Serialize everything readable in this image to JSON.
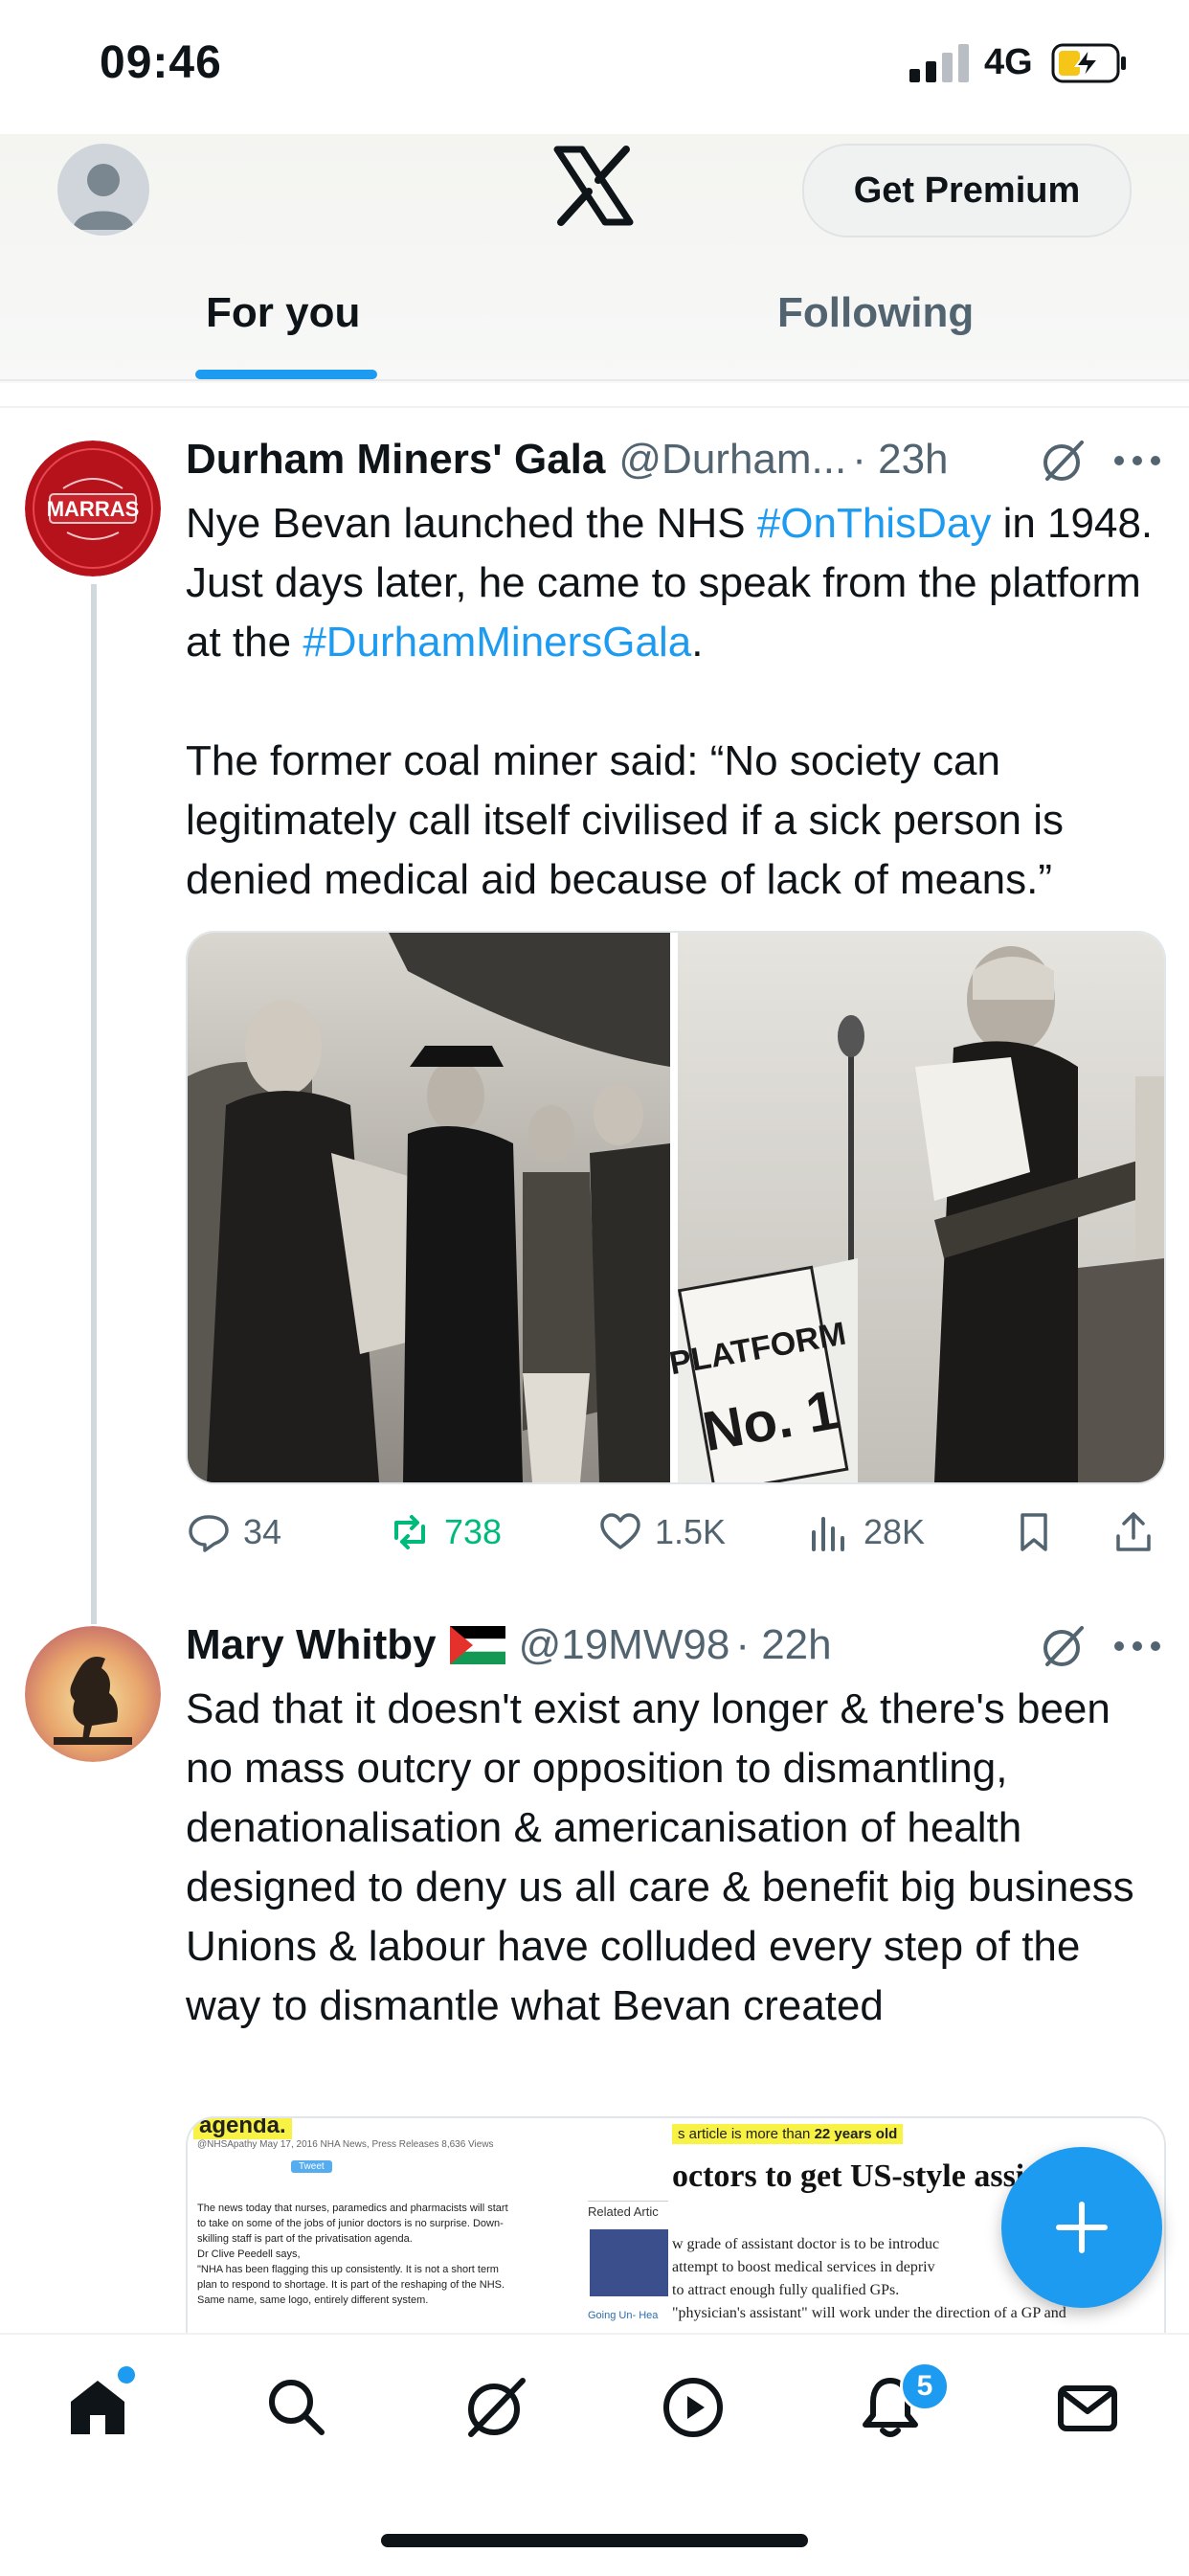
{
  "status_bar": {
    "time": "09:46",
    "network": "4G"
  },
  "header": {
    "premium_label": "Get Premium",
    "tabs": [
      {
        "label": "For you"
      },
      {
        "label": "Following"
      }
    ]
  },
  "tweets": [
    {
      "name": "Durham Miners' Gala",
      "handle": "@Durham...",
      "time": "· 23h",
      "avatar_text": "MARRAS",
      "body": [
        [
          {
            "t": "Nye Bevan launched the NHS "
          },
          {
            "t": "#OnThisDay",
            "tag": true
          },
          {
            "t": " in 1948. Just days later, he came to speak from the platform at the "
          },
          {
            "t": "#DurhamMinersGala",
            "tag": true
          },
          {
            "t": "."
          }
        ],
        [
          {
            "t": "The former coal miner said: “No society can legitimately call itself civilised if a sick person is denied medical aid because of lack of means.”"
          }
        ]
      ],
      "media": {
        "sign_line1": "PLATFORM",
        "sign_line2": "No. 1"
      },
      "stats": {
        "replies": "34",
        "reposts": "738",
        "likes": "1.5K",
        "views": "28K"
      }
    },
    {
      "name": "Mary Whitby",
      "flag": "🇵🇸",
      "handle": "@19MW98",
      "time": "· 22h",
      "body": [
        [
          {
            "t": "Sad that it doesn't exist any longer & there's been no mass outcry or opposition to dismantling, denationalisation & americanisation of health designed to deny us all care & benefit big business"
          }
        ],
        [
          {
            "t": "Unions & labour have colluded every step of the way to dismantle what Bevan created"
          }
        ]
      ],
      "media": {
        "left": {
          "heading": "agenda.",
          "meta": "@NHSApathy   May 17, 2016   NHA News, Press Releases   8,636 Views",
          "tweet_btn": "Tweet",
          "lines": [
            "The news today that nurses, paramedics and pharmacists will start",
            "to take on some of the jobs of junior doctors is no surprise. Down-",
            "skilling staff is part of the privatisation agenda.",
            "Dr Clive Peedell says,",
            "\"NHA has been flagging this up consistently. It is not a short term",
            "plan to respond to shortage. It is part of the reshaping of the NHS.",
            "Same name, same logo, entirely different system."
          ],
          "related": "Related Artic",
          "going": "Going Un- Hea"
        },
        "right": {
          "banner_pre": "s article is more than ",
          "banner_bold": "22 years old",
          "headline": "octors to get US-style assis",
          "lines": [
            "w grade of assistant doctor is to be introduc",
            "attempt to boost medical services in depriv",
            "to attract enough fully qualified GPs.",
            "\"physician's assistant\" will work under the direction of a GP and"
          ]
        }
      }
    }
  ],
  "tabbar": {
    "notifications_count": "5"
  }
}
